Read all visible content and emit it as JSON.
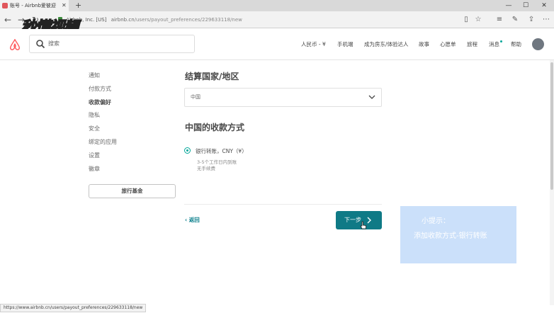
{
  "browser": {
    "tab_title": "账号 - Airbnb爱彼迎",
    "tab_close": "✕",
    "new_tab": "+",
    "window_controls": {
      "minimize": "—",
      "maximize": "☐",
      "close": "✕"
    },
    "url_site": "Airbnb, Inc. [US]",
    "url_domain": "airbnb.cn",
    "url_path": "/users/payout_preferences/229633118/new",
    "status_url": "https://www.airbnb.cn/users/payout_preferences/229633118/new"
  },
  "watermark": "秒懂视频",
  "header": {
    "search_placeholder": "搜索",
    "menu": [
      "人民币 - ¥",
      "手机端",
      "成为房东/体验达人",
      "故事",
      "心愿单",
      "旅程",
      "消息",
      "帮助"
    ]
  },
  "sidebar": {
    "items": [
      {
        "label": "通知",
        "active": false
      },
      {
        "label": "付款方式",
        "active": false
      },
      {
        "label": "收款偏好",
        "active": true
      },
      {
        "label": "隐私",
        "active": false
      },
      {
        "label": "安全",
        "active": false
      },
      {
        "label": "绑定的应用",
        "active": false
      },
      {
        "label": "设置",
        "active": false
      },
      {
        "label": "徽章",
        "active": false
      }
    ],
    "button_label": "旅行基金"
  },
  "main": {
    "country_heading": "结算国家/地区",
    "country_value": "中国",
    "methods_heading": "中国的收款方式",
    "option_title": "银行转账，CNY（¥）",
    "option_details": [
      "3-5个工作日内到账",
      "无手续费"
    ],
    "back_label": "返回",
    "next_label": "下一步"
  },
  "tip": {
    "line1": "小提示：",
    "line2": "添加收款方式-银行转账"
  },
  "colors": {
    "brand_red": "#FF5A5F",
    "teal": "#0F7A86",
    "tip_bg": "#CBE0FA"
  }
}
